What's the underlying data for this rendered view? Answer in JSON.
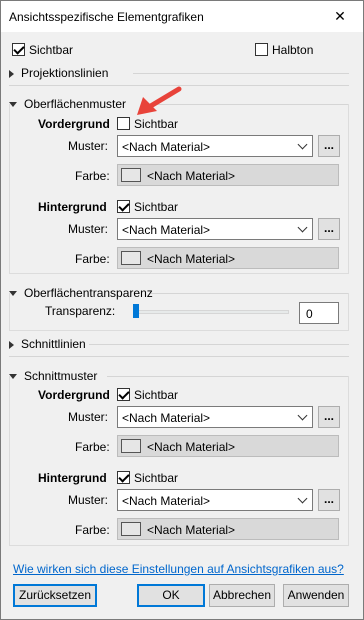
{
  "window": {
    "title": "Ansichtsspezifische Elementgrafiken",
    "close_glyph": "✕"
  },
  "top": {
    "visible_label": "Sichtbar",
    "visible_checked": true,
    "halftone_label": "Halbton",
    "halftone_checked": false
  },
  "sections": {
    "projection_lines": "Projektionslinien",
    "surface_patterns": "Oberflächenmuster",
    "surface_transparency": "Oberflächentransparenz",
    "cut_lines": "Schnittlinien",
    "cut_patterns": "Schnittmuster"
  },
  "labels": {
    "foreground": "Vordergrund",
    "background": "Hintergrund",
    "visible": "Sichtbar",
    "pattern": "Muster:",
    "color": "Farbe:",
    "transparency": "Transparenz:"
  },
  "surface": {
    "fg_visible": false,
    "fg_pattern": "<Nach Material>",
    "fg_color": "<Nach Material>",
    "bg_visible": true,
    "bg_pattern": "<Nach Material>",
    "bg_color": "<Nach Material>"
  },
  "transparency": {
    "value": "0",
    "level": 0
  },
  "cut": {
    "fg_visible": true,
    "fg_pattern": "<Nach Material>",
    "fg_color": "<Nach Material>",
    "bg_visible": true,
    "bg_pattern": "<Nach Material>",
    "bg_color": "<Nach Material>"
  },
  "dots_label": "...",
  "help_link": "Wie wirken sich diese Einstellungen auf Ansichtsgrafiken aus?",
  "buttons": {
    "reset": "Zurücksetzen",
    "ok": "OK",
    "cancel": "Abbrechen",
    "apply": "Anwenden"
  },
  "colors": {
    "accent": "#0078d7",
    "annotation_arrow": "#e8433a",
    "link": "#0066cc"
  }
}
